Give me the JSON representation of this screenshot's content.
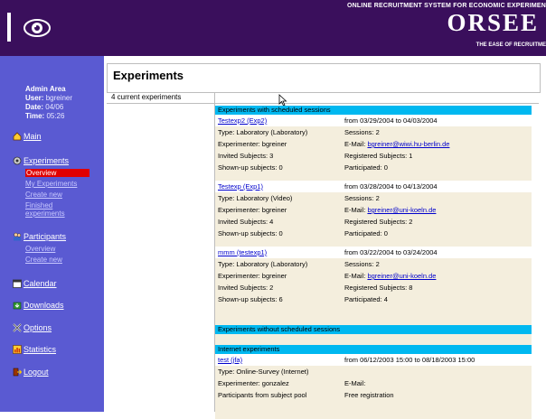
{
  "header": {
    "tagline_top": "ONLINE RECRUITMENT SYSTEM FOR ECONOMIC EXPERIMEN",
    "brand": "ORSEE",
    "tagline_bottom": "THE EASE OF RECRUITME",
    "bg_color": "#3a0f5c"
  },
  "sidebar": {
    "bg_color": "#5a5ad2",
    "admin_area": "Admin Area",
    "user_label": "User:",
    "user_value": "bgreiner",
    "date_label": "Date:",
    "date_value": "04/06",
    "time_label": "Time:",
    "time_value": "05:26",
    "items": {
      "main": "Main",
      "experiments": "Experiments",
      "exp_overview": "Overview",
      "exp_my": "My Experiments",
      "exp_create": "Create new",
      "exp_finished_1": "Finished",
      "exp_finished_2": "experiments",
      "participants": "Participants",
      "part_overview": "Overview",
      "part_create": "Create new",
      "calendar": "Calendar",
      "downloads": "Downloads",
      "options": "Options",
      "statistics": "Statistics",
      "logout": "Logout"
    }
  },
  "main": {
    "title": "Experiments",
    "summary": "4 current experiments",
    "section_scheduled": "Experiments with scheduled sessions",
    "section_unscheduled": "Experiments without scheduled sessions",
    "section_internet": "Internet experiments",
    "experiments": [
      {
        "name": "Testexp2 (Exp2)",
        "dates": "from 03/29/2004 to 04/03/2004",
        "type": "Type: Laboratory (Laboratory)",
        "sessions": "Sessions: 2",
        "experimenter": "Experimenter: bgreiner",
        "email_label": "E-Mail:",
        "email": "bgreiner@wiwi.hu-berlin.de",
        "invited": "Invited Subjects: 3",
        "registered": "Registered Subjects: 1",
        "shownup": "Shown-up subjects: 0",
        "participated": "Participated: 0"
      },
      {
        "name": "Testexp (Exp1)",
        "dates": "from 03/28/2004 to 04/13/2004",
        "type": "Type: Laboratory (Video)",
        "sessions": "Sessions: 2",
        "experimenter": "Experimenter: bgreiner",
        "email_label": "E-Mail:",
        "email": "bgreiner@uni-koeln.de",
        "invited": "Invited Subjects: 4",
        "registered": "Registered Subjects: 2",
        "shownup": "Shown-up subjects: 0",
        "participated": "Participated: 0"
      },
      {
        "name": "mmm (testexp1)",
        "dates": "from 03/22/2004 to 03/24/2004",
        "type": "Type: Laboratory (Laboratory)",
        "sessions": "Sessions: 2",
        "experimenter": "Experimenter: bgreiner",
        "email_label": "E-Mail:",
        "email": "bgreiner@uni-koeln.de",
        "invited": "Invited Subjects: 2",
        "registered": "Registered Subjects: 8",
        "shownup": "Shown-up subjects: 6",
        "participated": "Participated: 4"
      }
    ],
    "internet_experiment": {
      "name": "test (jfa)",
      "dates": "from 06/12/2003 15:00 to 08/18/2003 15:00",
      "type": "Type: Online-Survey (Internet)",
      "experimenter": "Experimenter: gonzalez",
      "email_label": "E-Mail:",
      "pool": "Participants from subject pool",
      "registration": "Free registration"
    },
    "band_color": "#00b8f0"
  }
}
